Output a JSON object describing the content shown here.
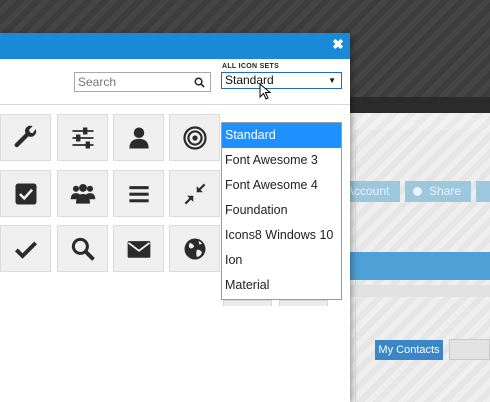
{
  "background": {
    "buttons": {
      "account_label": "Account",
      "share_label": "Share",
      "my_contacts_label": "My Contacts"
    }
  },
  "modal": {
    "close_icon": "✖",
    "search": {
      "placeholder": "Search",
      "icon": "search-icon"
    },
    "icon_set": {
      "label": "ALL ICON SETS",
      "selected": "Standard",
      "arrow": "▼"
    },
    "dropdown_options": [
      "Standard",
      "Font Awesome 3",
      "Font Awesome 4",
      "Foundation",
      "Icons8 Windows 10",
      "Ion",
      "Material"
    ],
    "selected_option_index": 0,
    "icon_grid": [
      [
        "wrench-icon",
        "sliders-icon",
        "user-icon",
        "target-icon"
      ],
      [
        "checkbox-icon",
        "users-icon",
        "menu-icon",
        "compress-icon"
      ],
      [
        "checkmark-icon",
        "search-icon",
        "envelope-icon",
        "globe-icon"
      ]
    ]
  },
  "colors": {
    "header": "#1a8ad8",
    "selected_option": "#1e90ff",
    "icon": "#2b2b2b"
  }
}
